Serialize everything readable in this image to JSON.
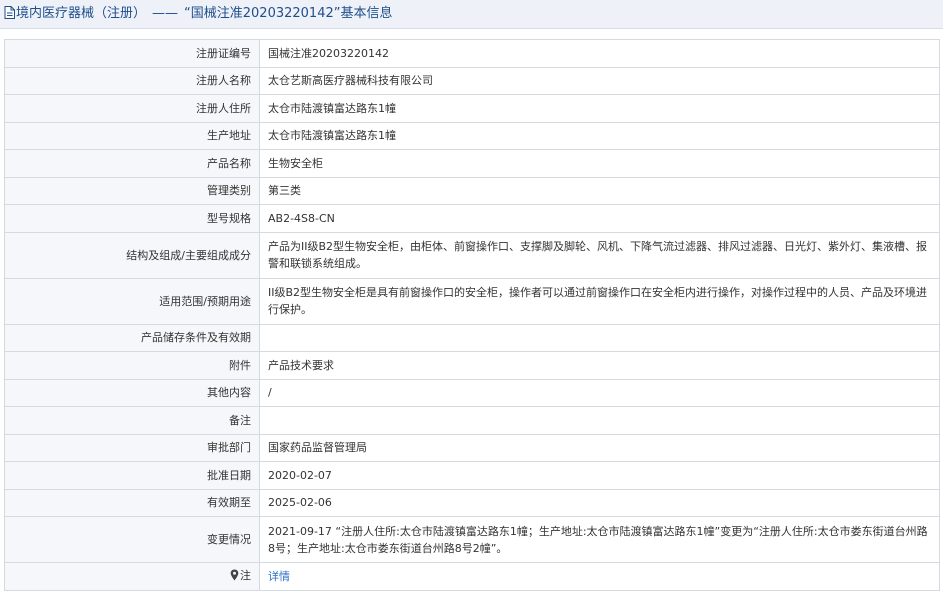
{
  "header": {
    "section": "境内医疗器械（注册）",
    "separator": "——",
    "record_title": "“国械注准20203220142”基本信息"
  },
  "rows": [
    {
      "label": "注册证编号",
      "value": "国械注准20203220142"
    },
    {
      "label": "注册人名称",
      "value": "太仓艺斯高医疗器械科技有限公司"
    },
    {
      "label": "注册人住所",
      "value": "太仓市陆渡镇富达路东1幢"
    },
    {
      "label": "生产地址",
      "value": "太仓市陆渡镇富达路东1幢"
    },
    {
      "label": "产品名称",
      "value": "生物安全柜"
    },
    {
      "label": "管理类别",
      "value": "第三类"
    },
    {
      "label": "型号规格",
      "value": "AB2-4S8-CN"
    },
    {
      "label": "结构及组成/主要组成成分",
      "value": "产品为II级B2型生物安全柜，由柜体、前窗操作口、支撑脚及脚轮、风机、下降气流过滤器、排风过滤器、日光灯、紫外灯、集液槽、报警和联锁系统组成。"
    },
    {
      "label": "适用范围/预期用途",
      "value": "II级B2型生物安全柜是具有前窗操作口的安全柜，操作者可以通过前窗操作口在安全柜内进行操作，对操作过程中的人员、产品及环境进行保护。"
    },
    {
      "label": "产品储存条件及有效期",
      "value": ""
    },
    {
      "label": "附件",
      "value": "产品技术要求"
    },
    {
      "label": "其他内容",
      "value": "/"
    },
    {
      "label": "备注",
      "value": ""
    },
    {
      "label": "审批部门",
      "value": "国家药品监督管理局"
    },
    {
      "label": "批准日期",
      "value": "2020-02-07"
    },
    {
      "label": "有效期至",
      "value": "2025-02-06"
    },
    {
      "label": "变更情况",
      "value": "2021-09-17 “注册人住所:太仓市陆渡镇富达路东1幢；生产地址:太仓市陆渡镇富达路东1幢”变更为“注册人住所:太仓市娄东街道台州路8号；生产地址:太仓市娄东街道台州路8号2幢”。"
    }
  ],
  "note_row": {
    "label": "注",
    "link_text": "详情",
    "icon": "pin-icon"
  },
  "colors": {
    "link": "#2a6fc7",
    "header_text": "#1f4e8c",
    "label_bg": "#f5f7fa",
    "border": "#d5d9e0"
  }
}
